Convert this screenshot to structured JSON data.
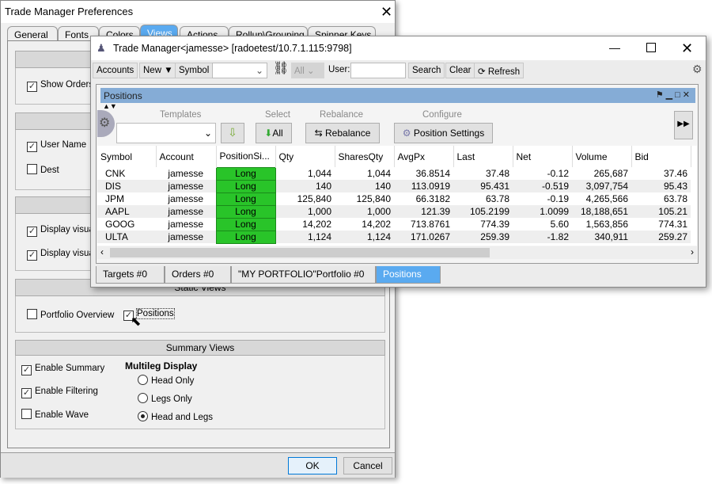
{
  "prefs": {
    "title": "Trade Manager Preferences",
    "tabs": [
      "General",
      "Fonts",
      "Colors",
      "Views",
      "Actions",
      "Rollup\\Grouping",
      "Spinner Keys"
    ],
    "active_tab": "Views",
    "sections": {
      "s1": {
        "show_orders": "Show Orders"
      },
      "s2": {
        "user_name": "User Name",
        "dest": "Dest"
      },
      "s3": {
        "display_visual_1": "Display visual",
        "display_visual_2": "Display visual"
      },
      "static": {
        "header": "Static Views",
        "portfolio_overview": "Portfolio Overview",
        "positions": "Positions"
      },
      "summary": {
        "header": "Summary Views",
        "enable_summary": "Enable Summary",
        "enable_filtering": "Enable Filtering",
        "enable_wave": "Enable Wave",
        "multileg_title": "Multileg Display",
        "head_only": "Head Only",
        "legs_only": "Legs Only",
        "head_and_legs": "Head and Legs",
        "selected": "Head and Legs"
      }
    },
    "ok": "OK",
    "cancel": "Cancel"
  },
  "tm": {
    "title": "Trade Manager<jamesse> [radoetest/10.7.1.115:9798]",
    "toolbar": {
      "accounts": "Accounts",
      "new": "New",
      "symbol": "Symbol",
      "symbol_value": "",
      "all": "All",
      "user_label": "User:",
      "user_value": "",
      "search": "Search",
      "clear": "Clear",
      "refresh": "Refresh"
    },
    "panel_title": "Positions",
    "groups": {
      "templates": "Templates",
      "select": "Select",
      "rebalance": "Rebalance",
      "configure": "Configure"
    },
    "buttons": {
      "all": "All",
      "rebalance": "Rebalance",
      "position_settings": "Position Settings"
    },
    "columns": [
      "Symbol",
      "Account",
      "PositionSi...",
      "Qty",
      "SharesQty",
      "AvgPx",
      "Last",
      "Net",
      "Volume",
      "Bid"
    ],
    "rows": [
      [
        "CNK",
        "jamesse",
        "Long",
        "1,044",
        "1,044",
        "36.8514",
        "37.48",
        "-0.12",
        "265,687",
        "37.46"
      ],
      [
        "DIS",
        "jamesse",
        "Long",
        "140",
        "140",
        "113.0919",
        "95.431",
        "-0.519",
        "3,097,754",
        "95.43"
      ],
      [
        "JPM",
        "jamesse",
        "Long",
        "125,840",
        "125,840",
        "66.3182",
        "63.78",
        "-0.19",
        "4,265,566",
        "63.78"
      ],
      [
        "AAPL",
        "jamesse",
        "Long",
        "1,000",
        "1,000",
        "121.39",
        "105.2199",
        "1.0099",
        "18,188,651",
        "105.21"
      ],
      [
        "GOOG",
        "jamesse",
        "Long",
        "14,202",
        "14,202",
        "713.8761",
        "774.39",
        "5.60",
        "1,563,856",
        "774.31"
      ],
      [
        "ULTA",
        "jamesse",
        "Long",
        "1,124",
        "1,124",
        "171.0267",
        "259.39",
        "-1.82",
        "340,911",
        "259.27"
      ]
    ],
    "bottom_tabs": [
      "Targets #0",
      "Orders #0",
      "\"MY PORTFOLIO\"Portfolio #0",
      "Positions"
    ],
    "colors": {
      "long": "#29c429",
      "header": "#85acd6",
      "active_tab": "#5aaaf0"
    }
  }
}
